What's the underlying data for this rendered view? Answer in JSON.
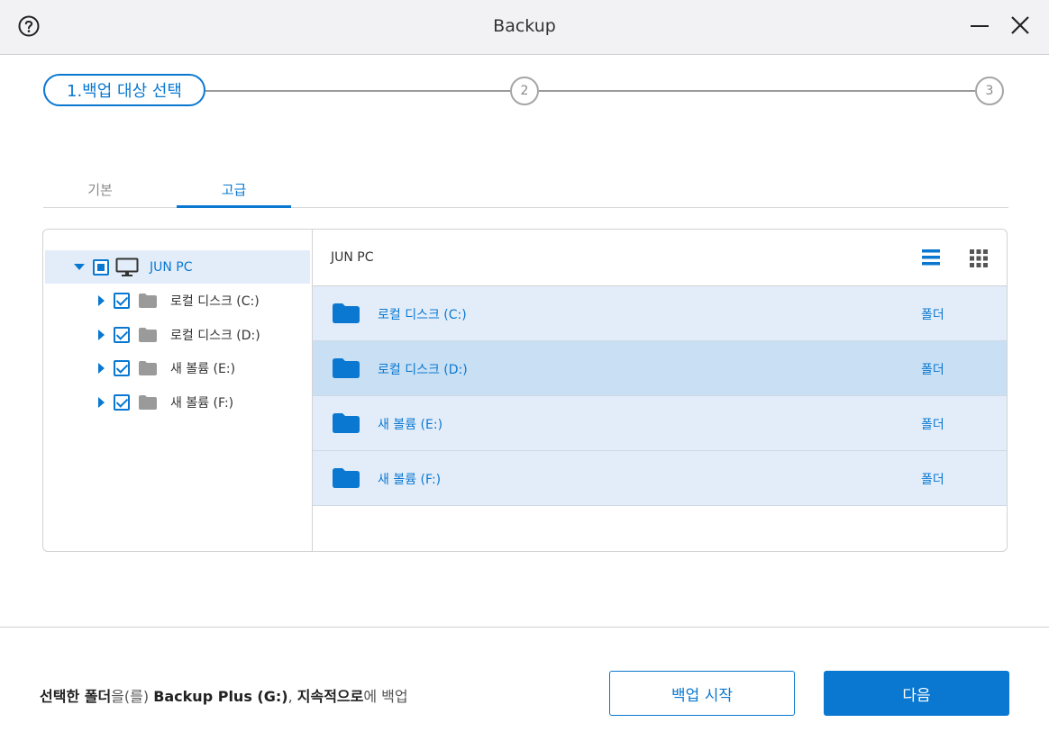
{
  "window": {
    "title": "Backup",
    "help_icon": "help-circle-icon",
    "minimize_icon": "minimize-icon",
    "close_icon": "close-icon"
  },
  "stepper": {
    "step1": "1.백업 대상 선택",
    "step2": "2",
    "step3": "3",
    "active_color": "#0a78d1"
  },
  "tabs": [
    {
      "label": "기본",
      "active": false
    },
    {
      "label": "고급",
      "active": true
    }
  ],
  "tree": {
    "root": {
      "label": "JUN PC",
      "icon": "monitor-icon",
      "state": "partial",
      "expanded": true
    },
    "items": [
      {
        "label": "로컬 디스크 (C:)",
        "icon": "folder-icon",
        "checked": true
      },
      {
        "label": "로컬 디스크 (D:)",
        "icon": "folder-icon",
        "checked": true
      },
      {
        "label": "새 볼륨 (E:)",
        "icon": "folder-icon",
        "checked": true
      },
      {
        "label": "새 볼륨 (F:)",
        "icon": "folder-icon",
        "checked": true
      }
    ]
  },
  "content": {
    "path": "JUN PC",
    "view_list_icon": "list-view-icon",
    "view_grid_icon": "grid-view-icon",
    "rows": [
      {
        "name": "로컬 디스크 (C:)",
        "type": "폴더",
        "selected": false
      },
      {
        "name": "로컬 디스크 (D:)",
        "type": "폴더",
        "selected": true
      },
      {
        "name": "새 볼륨 (E:)",
        "type": "폴더",
        "selected": false
      },
      {
        "name": "새 볼륨 (F:)",
        "type": "폴더",
        "selected": false
      }
    ]
  },
  "footer": {
    "desc_bold1": "선택한 폴더",
    "desc_text1": "을(를) ",
    "desc_bold2": "Backup Plus (G:)",
    "desc_text2": ", ",
    "desc_bold3": "지속적으로",
    "desc_text3": "에 백업",
    "start_button": "백업 시작",
    "next_button": "다음"
  }
}
